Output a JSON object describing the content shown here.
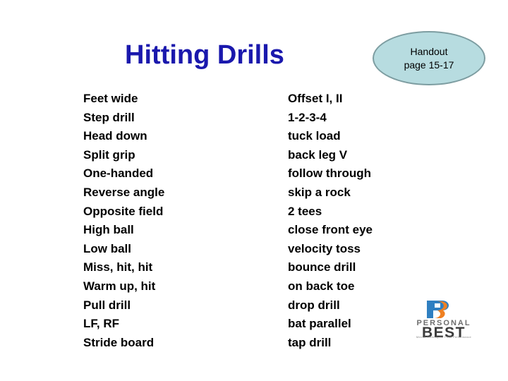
{
  "slide": {
    "title": "Hitting Drills",
    "title_color": "#1a18ad",
    "background_color": "#ffffff"
  },
  "handout_callout": {
    "shape": "ellipse",
    "fill_color": "#b7dce0",
    "border_color": "#7d9da1",
    "line1": "Handout",
    "line2": "page 15-17"
  },
  "columns": {
    "left": [
      "Feet wide",
      "Step drill",
      "Head down",
      "Split grip",
      "One-handed",
      "Reverse angle",
      "Opposite field",
      "High ball",
      "Low ball",
      "Miss, hit, hit",
      "Warm up, hit",
      "Pull drill",
      "LF, RF",
      "Stride board"
    ],
    "right": [
      "Offset I, II",
      "1-2-3-4",
      "tuck load",
      "back leg V",
      "follow through",
      "skip a rock",
      "2 tees",
      "close front eye",
      "velocity toss",
      "bounce drill",
      "on back toe",
      "drop drill",
      "bat parallel",
      "tap drill"
    ]
  },
  "logo": {
    "mark": "pb-monogram-icon",
    "mark_blue": "#2f7fc1",
    "mark_orange": "#ef8022",
    "word_top": "PERSONAL",
    "word_bottom": "BEST",
    "tagline": "Mental Training for Peak Performance"
  }
}
